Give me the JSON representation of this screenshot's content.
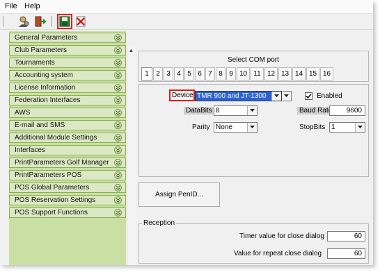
{
  "menu": {
    "file": "File",
    "help": "Help"
  },
  "toolbar": {
    "icons": [
      "user-settings-icon",
      "exit-icon",
      "save-icon",
      "close-document-icon"
    ]
  },
  "sidebar": {
    "items": [
      {
        "label": "General Parameters"
      },
      {
        "label": "Club Parameters"
      },
      {
        "label": "Tournaments"
      },
      {
        "label": "Accounting system"
      },
      {
        "label": "License Information"
      },
      {
        "label": "Federation Interfaces"
      },
      {
        "label": "AWS"
      },
      {
        "label": "E-mail and SMS"
      },
      {
        "label": "Additional Module Settings"
      },
      {
        "label": "Interfaces"
      },
      {
        "label": "PrintParameters Golf Manager"
      },
      {
        "label": "PrintParameters POS"
      },
      {
        "label": "POS Global Parameters"
      },
      {
        "label": "POS Reservation Settings"
      },
      {
        "label": "POS Support Functions"
      }
    ]
  },
  "com_port": {
    "title": "Select COM port",
    "ports": [
      "1",
      "2",
      "3",
      "4",
      "5",
      "6",
      "7",
      "8",
      "9",
      "10",
      "11",
      "12",
      "13",
      "14",
      "15",
      "16"
    ],
    "selected": "1"
  },
  "device": {
    "device_label": "Device",
    "device_value": "TMR 900 and JT-1300",
    "enabled_label": "Enabled",
    "enabled_checked": true,
    "databits_label": "DataBits",
    "databits_value": "8",
    "baudrate_label": "Baud Rate",
    "baudrate_value": "9600",
    "parity_label": "Parity",
    "parity_value": "None",
    "stopbits_label": "StopBits",
    "stopbits_value": "1"
  },
  "assign_button": "Assign PenID...",
  "reception": {
    "title": "Reception",
    "timer_label": "Timer value for close dialog",
    "timer_value": "60",
    "repeat_label": "Value for repeat close dialog",
    "repeat_value": "60"
  },
  "colors": {
    "sidebar_bg": "#dbe8c4",
    "sidebar_border": "#88b04e",
    "highlight": "#d81b1b",
    "selection": "#2a63d6"
  }
}
